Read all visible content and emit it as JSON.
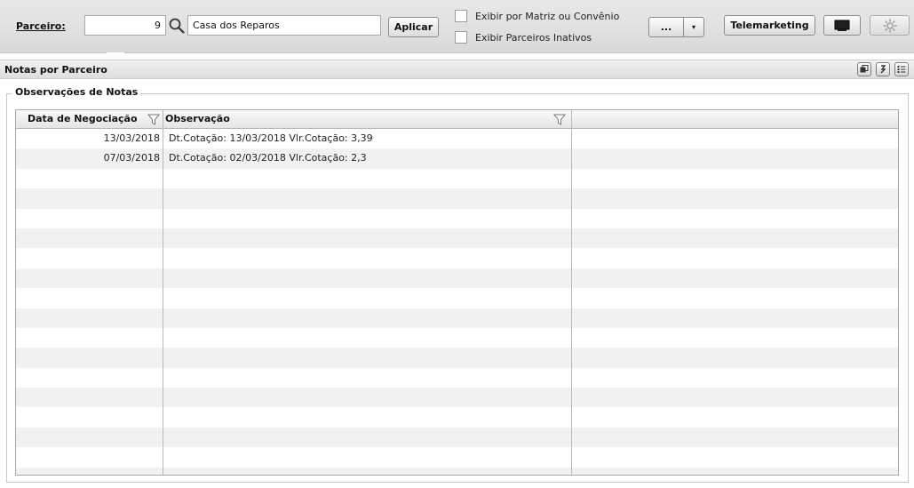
{
  "toolbar": {
    "partner_label": "Parceiro:",
    "partner_code": "9",
    "partner_name": "Casa dos Reparos",
    "apply_label": "Aplicar",
    "checkbox_matrix_label": "Exibir por Matriz ou Convênio",
    "checkbox_inactive_label": "Exibir Parceiros Inativos",
    "more_label": "...",
    "dropdown_arrow": "▾",
    "telemarketing_label": "Telemarketing"
  },
  "section": {
    "title": "Notas por Parceiro"
  },
  "fieldset": {
    "legend": "Observações de Notas"
  },
  "grid": {
    "columns": [
      "Data de Negociação",
      "Observação"
    ],
    "rows": [
      {
        "date": "13/03/2018",
        "obs": "Dt.Cotação: 13/03/2018 Vlr.Cotação: 3,39"
      },
      {
        "date": "07/03/2018",
        "obs": "Dt.Cotação: 02/03/2018 Vlr.Cotação: 2,3"
      },
      {
        "date": "",
        "obs": ""
      },
      {
        "date": "",
        "obs": ""
      },
      {
        "date": "",
        "obs": ""
      },
      {
        "date": "",
        "obs": ""
      },
      {
        "date": "",
        "obs": ""
      },
      {
        "date": "",
        "obs": ""
      },
      {
        "date": "",
        "obs": ""
      },
      {
        "date": "",
        "obs": ""
      },
      {
        "date": "",
        "obs": ""
      },
      {
        "date": "",
        "obs": ""
      },
      {
        "date": "",
        "obs": ""
      },
      {
        "date": "",
        "obs": ""
      },
      {
        "date": "",
        "obs": ""
      },
      {
        "date": "",
        "obs": ""
      },
      {
        "date": "",
        "obs": ""
      },
      {
        "date": "",
        "obs": ""
      }
    ]
  },
  "icons": {
    "search": "search-icon",
    "filter": "filter-icon",
    "monitor": "monitor-icon",
    "gear": "gear-icon",
    "copy": "copy-icon",
    "refresh": "refresh-icon",
    "list": "list-icon"
  }
}
